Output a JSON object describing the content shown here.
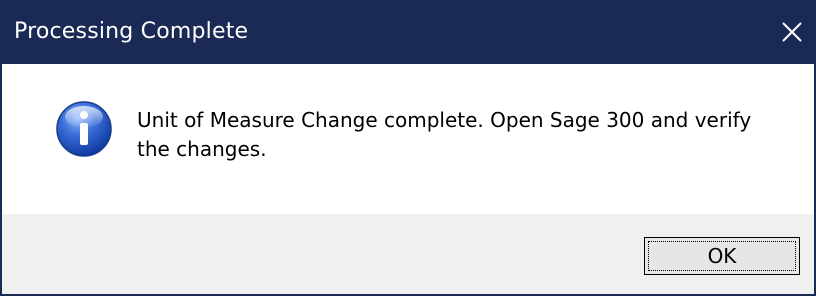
{
  "window": {
    "title": "Processing Complete",
    "titlebar_color": "#1b2a54"
  },
  "icons": {
    "close": "close-icon",
    "info": "info-icon"
  },
  "message": {
    "line1": "Unit of Measure Change complete. Open Sage 300 and verify",
    "line2": "the changes."
  },
  "buttons": {
    "ok_label": "OK"
  }
}
